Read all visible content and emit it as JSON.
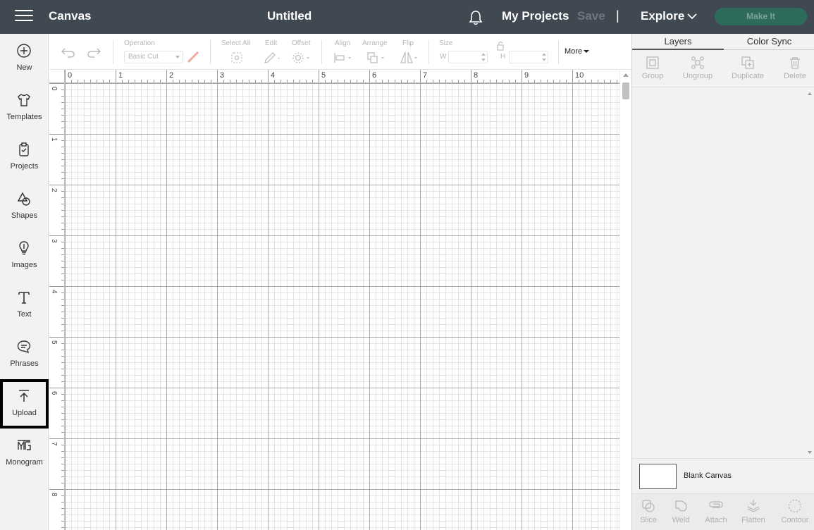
{
  "header": {
    "app_title": "Canvas",
    "doc_title": "Untitled",
    "my_projects": "My Projects",
    "save": "Save",
    "separator": "|",
    "explore": "Explore",
    "make_it": "Make It"
  },
  "sidebar": {
    "items": [
      {
        "label": "New",
        "icon": "plus-circle-icon"
      },
      {
        "label": "Templates",
        "icon": "tshirt-icon"
      },
      {
        "label": "Projects",
        "icon": "clipboard-icon"
      },
      {
        "label": "Shapes",
        "icon": "shapes-icon"
      },
      {
        "label": "Images",
        "icon": "lightbulb-icon"
      },
      {
        "label": "Text",
        "icon": "text-icon"
      },
      {
        "label": "Phrases",
        "icon": "speech-bubble-icon"
      },
      {
        "label": "Upload",
        "icon": "upload-icon"
      },
      {
        "label": "Monogram",
        "icon": "monogram-icon"
      }
    ],
    "selected": "Upload"
  },
  "toolbar": {
    "operation_label": "Operation",
    "operation_value": "Basic Cut",
    "select_all": "Select All",
    "edit": "Edit",
    "offset": "Offset",
    "align": "Align",
    "arrange": "Arrange",
    "flip": "Flip",
    "size": "Size",
    "w": "W",
    "h": "H",
    "more": "More"
  },
  "ruler": {
    "horizontal": [
      "0",
      "1",
      "2",
      "3",
      "4",
      "5",
      "6",
      "7",
      "8",
      "9",
      "10"
    ],
    "vertical": [
      "0",
      "1",
      "2",
      "3",
      "4",
      "5",
      "6",
      "7",
      "8"
    ]
  },
  "right_panel": {
    "tabs": [
      "Layers",
      "Color Sync"
    ],
    "active_tab": "Layers",
    "actions": [
      "Group",
      "Ungroup",
      "Duplicate",
      "Delete"
    ],
    "blank_canvas": "Blank Canvas",
    "bottom_actions": [
      "Slice",
      "Weld",
      "Attach",
      "Flatten",
      "Contour"
    ]
  },
  "colors": {
    "header_bg": "#404852",
    "make_it_bg": "#2f6b5b",
    "sidebar_bg": "#f2f2f2",
    "selected_border": "#000000"
  }
}
